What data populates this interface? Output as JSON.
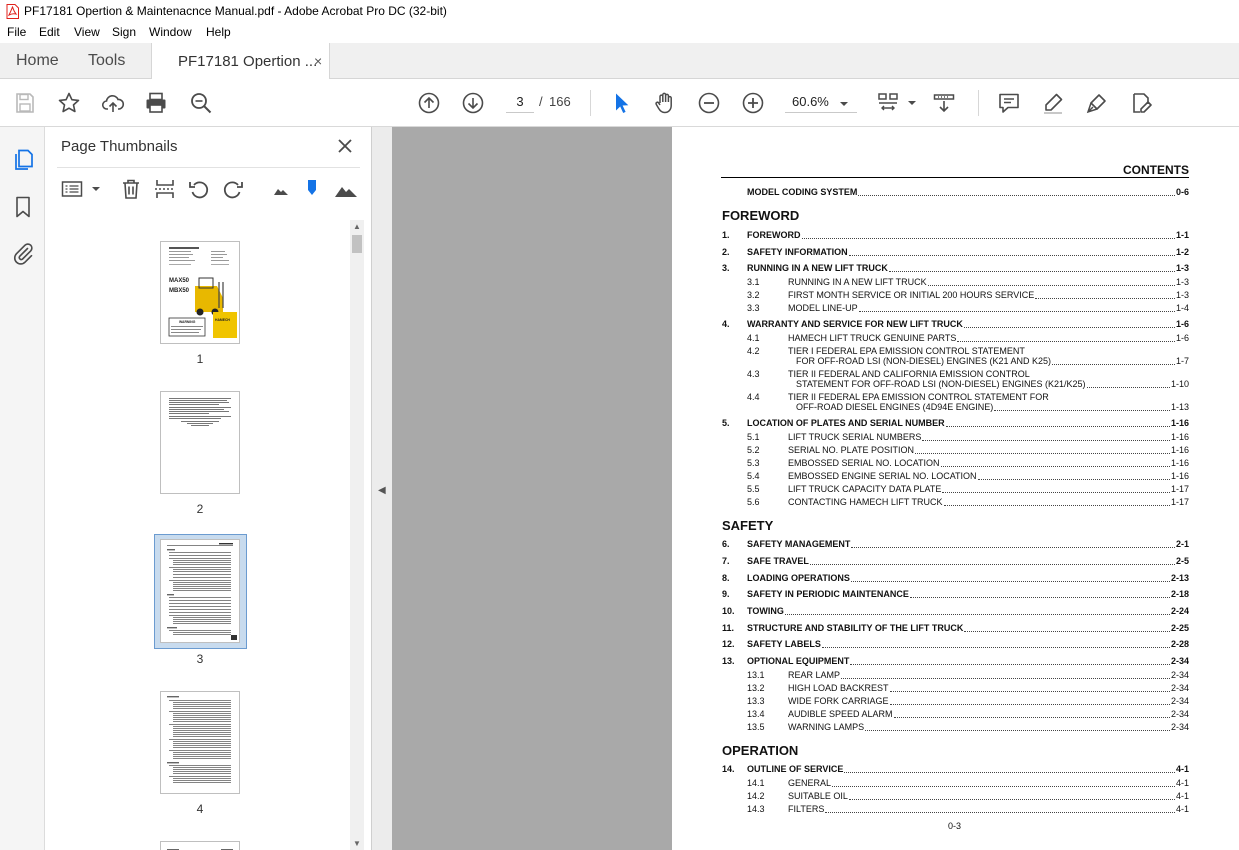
{
  "window": {
    "title": "PF17181 Opertion & Maintenacnce Manual.pdf - Adobe Acrobat Pro DC (32-bit)"
  },
  "menu": [
    "File",
    "Edit",
    "View",
    "Sign",
    "Window",
    "Help"
  ],
  "tabs": {
    "home": "Home",
    "tools": "Tools",
    "document": "PF17181 Opertion ...",
    "close_glyph": "×"
  },
  "toolbar": {
    "current_page": "3",
    "page_separator": "/",
    "total_pages": "166",
    "zoom": "60.6%"
  },
  "thumbnails_panel": {
    "title": "Page Thumbnails",
    "pages": [
      "1",
      "2",
      "3",
      "4"
    ],
    "selected_page": "3",
    "page1_text": [
      "MAX50",
      "MBX50",
      "WARNING",
      "HAMECH"
    ]
  },
  "document": {
    "heading": "CONTENTS",
    "footer": "0-3",
    "rows": [
      {
        "num": "",
        "text": "MODEL CODING SYSTEM",
        "page": "0-6",
        "level": "main"
      },
      {
        "section": "FOREWORD"
      },
      {
        "num": "1.",
        "text": "FOREWORD",
        "page": "1-1",
        "level": "main"
      },
      {
        "num": "2.",
        "text": "SAFETY INFORMATION",
        "page": "1-2",
        "level": "main"
      },
      {
        "num": "3.",
        "text": "RUNNING IN A NEW LIFT TRUCK",
        "page": "1-3",
        "level": "main"
      },
      {
        "num": "3.1",
        "text": "RUNNING IN A NEW LIFT TRUCK",
        "page": "1-3",
        "level": "sub"
      },
      {
        "num": "3.2",
        "text": "FIRST MONTH SERVICE OR INITIAL 200 HOURS SERVICE",
        "page": "1-3",
        "level": "sub"
      },
      {
        "num": "3.3",
        "text": "MODEL LINE-UP",
        "page": "1-4",
        "level": "sub"
      },
      {
        "num": "4.",
        "text": "WARRANTY AND SERVICE FOR NEW LIFT TRUCK",
        "page": "1-6",
        "level": "main"
      },
      {
        "num": "4.1",
        "text": "HAMECH LIFT TRUCK GENUINE PARTS",
        "page": "1-6",
        "level": "sub"
      },
      {
        "num": "4.2",
        "text": "TIER I FEDERAL EPA EMISSION CONTROL STATEMENT",
        "text2": "FOR OFF-ROAD LSI (NON-DIESEL) ENGINES (K21 AND K25)",
        "page": "1-7",
        "level": "sub2"
      },
      {
        "num": "4.3",
        "text": "TIER II FEDERAL AND CALIFORNIA EMISSION CONTROL",
        "text2": "STATEMENT FOR OFF-ROAD LSI (NON-DIESEL) ENGINES (K21/K25)",
        "page": "1-10",
        "level": "sub2"
      },
      {
        "num": "4.4",
        "text": "TIER II FEDERAL EPA EMISSION CONTROL STATEMENT FOR",
        "text2": "OFF-ROAD DIESEL ENGINES (4D94E ENGINE)",
        "page": "1-13",
        "level": "sub2"
      },
      {
        "num": "5.",
        "text": "LOCATION OF PLATES AND SERIAL NUMBER",
        "page": "1-16",
        "level": "main"
      },
      {
        "num": "5.1",
        "text": "LIFT TRUCK SERIAL NUMBERS",
        "page": "1-16",
        "level": "sub"
      },
      {
        "num": "5.2",
        "text": "SERIAL NO. PLATE POSITION",
        "page": "1-16",
        "level": "sub"
      },
      {
        "num": "5.3",
        "text": "EMBOSSED SERIAL NO. LOCATION",
        "page": "1-16",
        "level": "sub"
      },
      {
        "num": "5.4",
        "text": "EMBOSSED ENGINE SERIAL NO. LOCATION",
        "page": "1-16",
        "level": "sub"
      },
      {
        "num": "5.5",
        "text": "LIFT TRUCK CAPACITY DATA PLATE",
        "page": "1-17",
        "level": "sub"
      },
      {
        "num": "5.6",
        "text": "CONTACTING HAMECH LIFT TRUCK",
        "page": "1-17",
        "level": "sub"
      },
      {
        "section": "SAFETY"
      },
      {
        "num": "6.",
        "text": "SAFETY MANAGEMENT",
        "page": "2-1",
        "level": "main"
      },
      {
        "num": "7.",
        "text": "SAFE TRAVEL",
        "page": "2-5",
        "level": "main"
      },
      {
        "num": "8.",
        "text": "LOADING OPERATIONS",
        "page": "2-13",
        "level": "main"
      },
      {
        "num": "9.",
        "text": "SAFETY IN PERIODIC MAINTENANCE",
        "page": "2-18",
        "level": "main"
      },
      {
        "num": "10.",
        "text": "TOWING",
        "page": "2-24",
        "level": "main"
      },
      {
        "num": "11.",
        "text": "STRUCTURE AND STABILITY OF THE LIFT TRUCK",
        "page": "2-25",
        "level": "main"
      },
      {
        "num": "12.",
        "text": "SAFETY LABELS",
        "page": "2-28",
        "level": "main"
      },
      {
        "num": "13.",
        "text": "OPTIONAL EQUIPMENT",
        "page": "2-34",
        "level": "main"
      },
      {
        "num": "13.1",
        "text": "REAR LAMP",
        "page": "2-34",
        "level": "sub"
      },
      {
        "num": "13.2",
        "text": "HIGH LOAD BACKREST",
        "page": "2-34",
        "level": "sub"
      },
      {
        "num": "13.3",
        "text": "WIDE FORK CARRIAGE",
        "page": "2-34",
        "level": "sub"
      },
      {
        "num": "13.4",
        "text": "AUDIBLE SPEED ALARM",
        "page": "2-34",
        "level": "sub"
      },
      {
        "num": "13.5",
        "text": "WARNING LAMPS",
        "page": "2-34",
        "level": "sub"
      },
      {
        "section": "OPERATION"
      },
      {
        "num": "14.",
        "text": "OUTLINE OF SERVICE",
        "page": "4-1",
        "level": "main"
      },
      {
        "num": "14.1",
        "text": "GENERAL",
        "page": "4-1",
        "level": "sub"
      },
      {
        "num": "14.2",
        "text": "SUITABLE OIL",
        "page": "4-1",
        "level": "sub"
      },
      {
        "num": "14.3",
        "text": "FILTERS",
        "page": "4-1",
        "level": "sub"
      }
    ]
  },
  "colors": {
    "accent_blue": "#1473e6",
    "doc_background": "#a9a9a9",
    "pdf_red": "#e0201b"
  }
}
